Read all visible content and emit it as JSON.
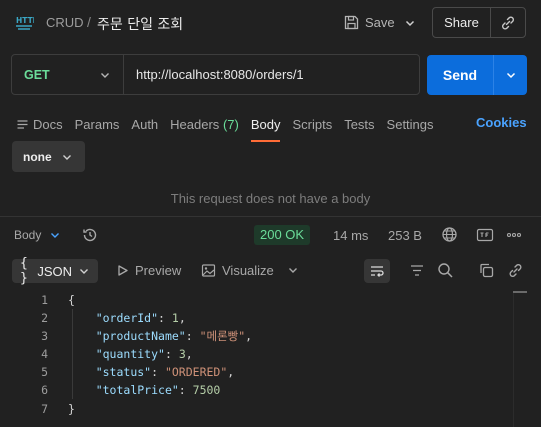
{
  "header": {
    "parent": "CRUD",
    "separator": "/",
    "title": "주문 단일 조회",
    "save_label": "Save",
    "share_label": "Share"
  },
  "request": {
    "method": "GET",
    "url": "http://localhost:8080/orders/1",
    "send_label": "Send"
  },
  "tabs": {
    "docs": "Docs",
    "params": "Params",
    "auth": "Auth",
    "headers": "Headers",
    "headers_count": "(7)",
    "body": "Body",
    "scripts": "Scripts",
    "tests": "Tests",
    "settings": "Settings",
    "cookies": "Cookies",
    "active": "Body"
  },
  "body_editor": {
    "type": "none",
    "empty_message": "This request does not have a body"
  },
  "response": {
    "body_label": "Body",
    "status": "200 OK",
    "time": "14 ms",
    "size": "253 B",
    "format": "JSON",
    "format_brace": "{ }",
    "preview_label": "Preview",
    "visualize_label": "Visualize",
    "lines": [
      {
        "n": "1",
        "indent": "",
        "parts": [
          {
            "t": "{",
            "c": "p"
          }
        ]
      },
      {
        "n": "2",
        "indent": "    ",
        "parts": [
          {
            "t": "\"orderId\"",
            "c": "k"
          },
          {
            "t": ": ",
            "c": "p"
          },
          {
            "t": "1",
            "c": "n"
          },
          {
            "t": ",",
            "c": "p"
          }
        ]
      },
      {
        "n": "3",
        "indent": "    ",
        "parts": [
          {
            "t": "\"productName\"",
            "c": "k"
          },
          {
            "t": ": ",
            "c": "p"
          },
          {
            "t": "\"메론빵\"",
            "c": "s"
          },
          {
            "t": ",",
            "c": "p"
          }
        ]
      },
      {
        "n": "4",
        "indent": "    ",
        "parts": [
          {
            "t": "\"quantity\"",
            "c": "k"
          },
          {
            "t": ": ",
            "c": "p"
          },
          {
            "t": "3",
            "c": "n"
          },
          {
            "t": ",",
            "c": "p"
          }
        ]
      },
      {
        "n": "5",
        "indent": "    ",
        "parts": [
          {
            "t": "\"status\"",
            "c": "k"
          },
          {
            "t": ": ",
            "c": "p"
          },
          {
            "t": "\"ORDERED\"",
            "c": "s"
          },
          {
            "t": ",",
            "c": "p"
          }
        ]
      },
      {
        "n": "6",
        "indent": "    ",
        "parts": [
          {
            "t": "\"totalPrice\"",
            "c": "k"
          },
          {
            "t": ": ",
            "c": "p"
          },
          {
            "t": "7500",
            "c": "n"
          }
        ]
      },
      {
        "n": "7",
        "indent": "",
        "parts": [
          {
            "t": "}",
            "c": "p"
          }
        ]
      }
    ]
  },
  "colors": {
    "accent": "#ff6c37",
    "send": "#0c6ddc",
    "method_get": "#6bdd9a",
    "status_ok": "#6bdd9a",
    "link": "#4aa3ff"
  },
  "icons": [
    "http-request-icon",
    "save-icon",
    "chevron-down-icon",
    "link-icon",
    "docs-icon",
    "history-icon",
    "globe-icon",
    "save-response-icon",
    "more-icon",
    "play-icon",
    "image-icon",
    "wrap-lines-icon",
    "filter-icon",
    "search-icon",
    "copy-icon"
  ]
}
